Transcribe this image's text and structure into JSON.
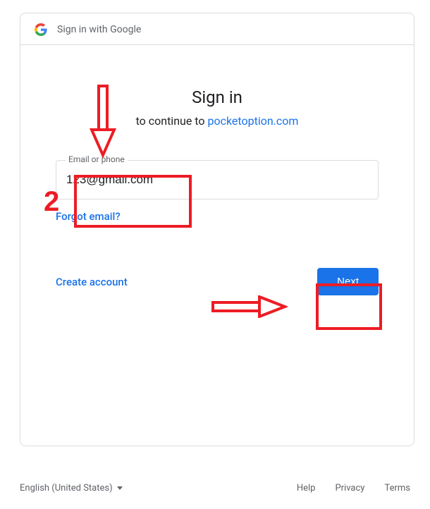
{
  "header": {
    "brand_label": "Sign in with Google"
  },
  "title": "Sign in",
  "subtitle_prefix": "to continue to ",
  "site": "pocketoption.com",
  "input": {
    "label": "Email or phone",
    "value": "123@gmail.com"
  },
  "links": {
    "forgot": "Forgot email?",
    "create": "Create account"
  },
  "buttons": {
    "next": "Next"
  },
  "footer": {
    "lang": "English (United States)",
    "help": "Help",
    "privacy": "Privacy",
    "terms": "Terms"
  },
  "annotations": {
    "step_number": "2"
  },
  "colors": {
    "accent": "#1a73e8",
    "annotation": "#ed1c24"
  }
}
